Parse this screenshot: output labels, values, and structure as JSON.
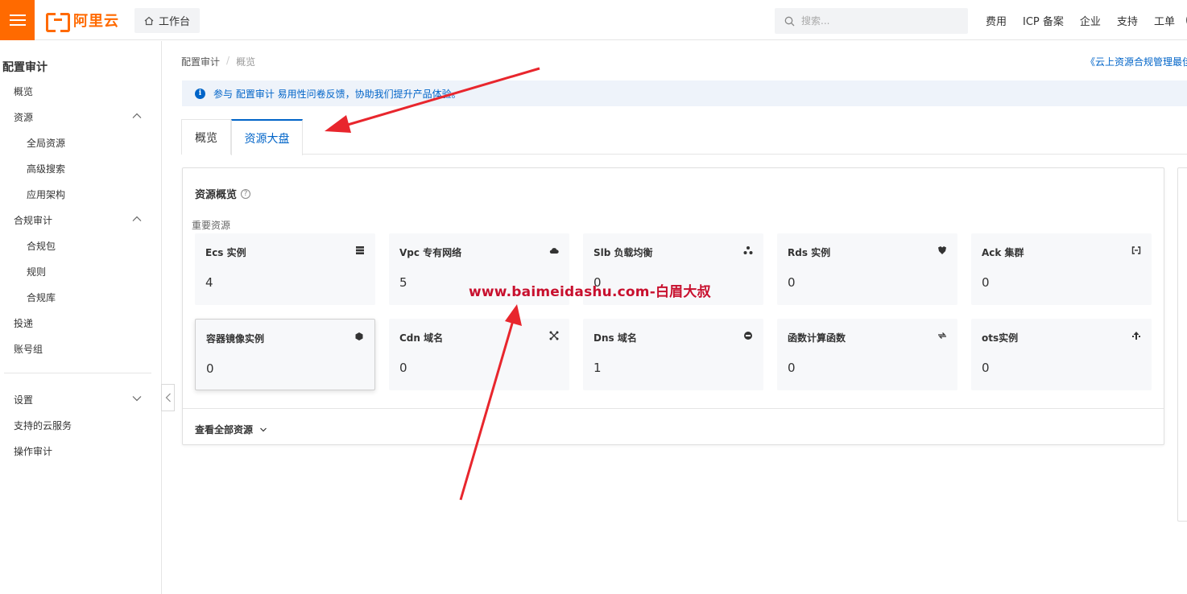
{
  "header": {
    "logo_text": "阿里云",
    "workbench_label": "工作台",
    "search_placeholder": "搜索...",
    "nav": [
      "费用",
      "ICP 备案",
      "企业",
      "支持",
      "工单"
    ]
  },
  "sidebar": {
    "title": "配置审计",
    "items": [
      {
        "label": "概览",
        "level": 1
      },
      {
        "label": "资源",
        "level": 1,
        "expanded": true
      },
      {
        "label": "全局资源",
        "level": 2
      },
      {
        "label": "高级搜索",
        "level": 2
      },
      {
        "label": "应用架构",
        "level": 2
      },
      {
        "label": "合规审计",
        "level": 1,
        "expanded": true
      },
      {
        "label": "合规包",
        "level": 2
      },
      {
        "label": "规则",
        "level": 2
      },
      {
        "label": "合规库",
        "level": 2
      },
      {
        "label": "投递",
        "level": 1
      },
      {
        "label": "账号组",
        "level": 1
      },
      {
        "label": "设置",
        "level": 1,
        "expanded": false
      },
      {
        "label": "支持的云服务",
        "level": 1
      },
      {
        "label": "操作审计",
        "level": 1
      }
    ]
  },
  "breadcrumb": {
    "root": "配置审计",
    "sep": "/",
    "current": "概览"
  },
  "top_link": "《云上资源合规管理最佳",
  "notice": {
    "text": "参与 配置审计 易用性问卷反馈，协助我们提升产品体验。"
  },
  "tabs": [
    {
      "label": "概览",
      "active": false
    },
    {
      "label": "资源大盘",
      "active": true
    }
  ],
  "overview": {
    "title": "资源概览",
    "subtitle": "重要资源",
    "view_all": "查看全部资源",
    "tiles": [
      {
        "name": "Ecs 实例",
        "value": "4",
        "icon": "server-icon"
      },
      {
        "name": "Vpc 专有网络",
        "value": "5",
        "icon": "cloud-icon"
      },
      {
        "name": "Slb 负载均衡",
        "value": "0",
        "icon": "balancer-icon"
      },
      {
        "name": "Rds 实例",
        "value": "0",
        "icon": "database-icon"
      },
      {
        "name": "Ack 集群",
        "value": "0",
        "icon": "cluster-icon"
      },
      {
        "name": "容器镜像实例",
        "value": "0",
        "icon": "container-icon"
      },
      {
        "name": "Cdn 域名",
        "value": "0",
        "icon": "cdn-icon"
      },
      {
        "name": "Dns 域名",
        "value": "1",
        "icon": "dns-icon"
      },
      {
        "name": "函数计算函数",
        "value": "0",
        "icon": "function-icon"
      },
      {
        "name": "ots实例",
        "value": "0",
        "icon": "ots-icon"
      }
    ]
  },
  "watermark": "www.baimeidashu.com-白眉大叔",
  "colors": {
    "brand": "#ff6a00",
    "link": "#0064c8",
    "annotation": "#e8262d"
  }
}
